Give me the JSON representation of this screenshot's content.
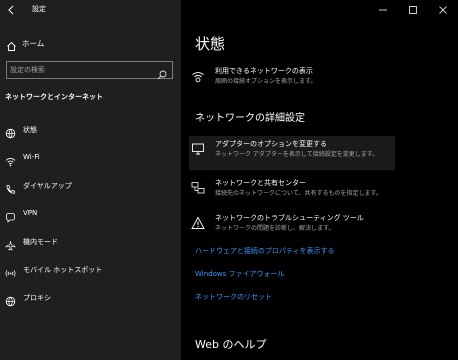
{
  "window": {
    "title": "設定",
    "back_icon": "back-arrow-icon"
  },
  "sidebar": {
    "home_label": "ホーム",
    "search_placeholder": "設定の検索",
    "section_title": "ネットワークとインターネット",
    "items": [
      {
        "label": "状態",
        "icon": "home-globe-icon"
      },
      {
        "label": "Wi-Fi",
        "icon": "wifi-icon"
      },
      {
        "label": "ダイヤルアップ",
        "icon": "phone-icon"
      },
      {
        "label": "VPN",
        "icon": "vpn-icon"
      },
      {
        "label": "機内モード",
        "icon": "airplane-icon"
      },
      {
        "label": "モバイル ホットスポット",
        "icon": "hotspot-icon"
      },
      {
        "label": "プロキシ",
        "icon": "globe-icon"
      }
    ]
  },
  "main": {
    "title": "状態",
    "available_networks": {
      "title": "利用できるネットワークの表示",
      "desc": "周囲の接続オプションを表示します。"
    },
    "advanced_heading": "ネットワークの詳細設定",
    "adapter_options": {
      "title": "アダプターのオプションを変更する",
      "desc": "ネットワーク アダプターを表示して接続設定を変更します。"
    },
    "sharing_center": {
      "title": "ネットワークと共有センター",
      "desc": "接続先のネットワークについて、共有するものを指定します。"
    },
    "troubleshooter": {
      "title": "ネットワークのトラブルシューティング ツール",
      "desc": "ネットワークの問題を診断し、解決します。"
    },
    "links": [
      "ハードウェアと接続のプロパティを表示する",
      "Windows ファイアウォール",
      "ネットワークのリセット"
    ],
    "help_heading": "Web のヘルプ"
  },
  "colors": {
    "accent": "#3399ff",
    "sidebar_bg": "#1f1f1f",
    "content_bg": "#000000"
  }
}
